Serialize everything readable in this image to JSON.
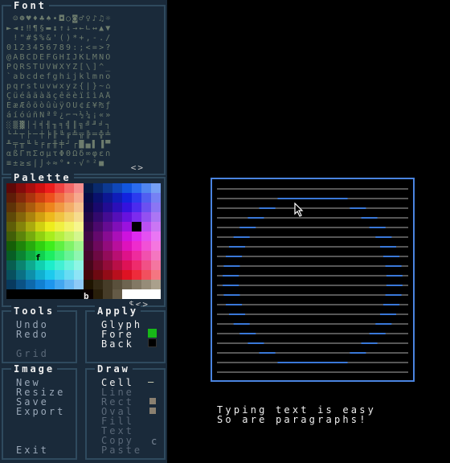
{
  "font_panel": {
    "title": "Font",
    "rows": [
      " ☺☻♥♦♣♠•◘○◙♂♀♪♫☼",
      "►◄↕‼¶§▬↨↑↓→←∟↔▲▼",
      " !\"#$%&'()*+,-./",
      "0123456789:;<=>?",
      "@ABCDEFGHIJKLMNO",
      "PQRSTUVWXYZ[\\]^_",
      "`abcdefghijklmno",
      "pqrstuvwxyz{|}~⌂",
      "ÇüéâäàåçêëèïîìÄÅ",
      "ÉæÆôöòûùÿÖÜ¢£¥₧ƒ",
      "áíóúñÑªº¿⌐¬½¼¡«»",
      "░▒▓│┤╡╢╖╕╣║╗╝╜╛┐",
      "└┴┬├─┼╞╟╚╔╩╦╠═╬╧",
      "╨╤╥╙╘╒╓╫╪┘┌█▄▌▐▀",
      "αßΓπΣσµτΦΘΩδ∞φε∩",
      "≡±≥≤⌠⌡÷≈°∙·√ⁿ²■ "
    ],
    "nav": "<>"
  },
  "palette_panel": {
    "title": "Palette",
    "fore_marker": "f",
    "back_marker": "b",
    "nav": "$<>"
  },
  "tools_panel": {
    "title": "Tools",
    "items": [
      "Undo",
      "Redo",
      "Grid"
    ]
  },
  "apply_panel": {
    "title": "Apply",
    "items": [
      "Glyph",
      "Fore",
      "Back"
    ],
    "fore_color": "#18b818",
    "back_color": "#000000"
  },
  "image_panel": {
    "title": "Image",
    "items": [
      "New",
      "Resize",
      "Save",
      "Export",
      "Exit"
    ]
  },
  "draw_panel": {
    "title": "Draw",
    "items": [
      "Cell",
      "Line",
      "Rect",
      "Oval",
      "Fill",
      "Text",
      "Copy",
      "Paste"
    ],
    "cell_indicator": "—",
    "copy_indicator": "c"
  },
  "canvas": {
    "caption_line1": "Typing text is easy",
    "caption_line2": "So are paragraphs!",
    "frame_color": "#4a84e0",
    "line_color": "#8a8a8a",
    "oval_color": "#3a78d8"
  }
}
